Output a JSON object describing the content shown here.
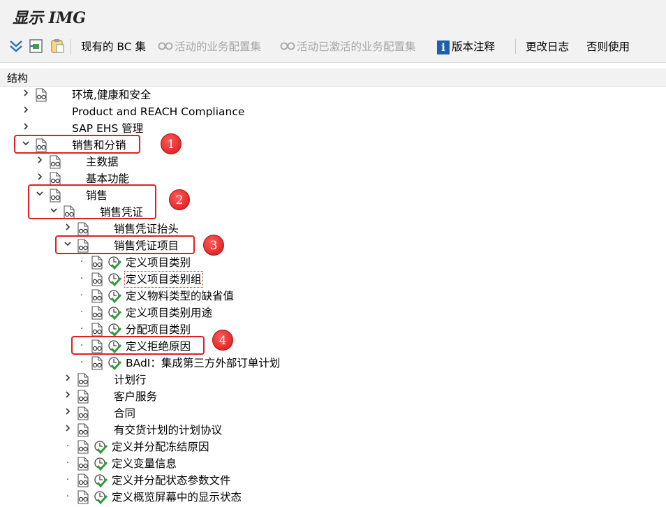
{
  "window": {
    "title": "显示 IMG"
  },
  "toolbar": {
    "bc_sets_label": "现有的 BC 集",
    "active_bc_label": "活动的业务配置集",
    "activated_bc_label": "活动已激活的业务配置集",
    "release_notes_label": "版本注释",
    "change_log_label": "更改日志",
    "otherwise_label": "否则使用"
  },
  "structure": {
    "header": "结构"
  },
  "tree": [
    {
      "label": "环境,健康和安全",
      "chevron": ">",
      "doc": true,
      "exec": false,
      "indent": 0
    },
    {
      "label": "Product and REACH Compliance",
      "chevron": ">",
      "doc": false,
      "exec": false,
      "indent": 0
    },
    {
      "label": "SAP EHS 管理",
      "chevron": ">",
      "doc": false,
      "exec": false,
      "indent": 0
    },
    {
      "label": "销售和分销",
      "chevron": "v",
      "doc": true,
      "exec": false,
      "indent": 0
    },
    {
      "label": "主数据",
      "chevron": ">",
      "doc": true,
      "exec": false,
      "indent": 1
    },
    {
      "label": "基本功能",
      "chevron": ">",
      "doc": true,
      "exec": false,
      "indent": 1
    },
    {
      "label": "销售",
      "chevron": "v",
      "doc": true,
      "exec": false,
      "indent": 1
    },
    {
      "label": "销售凭证",
      "chevron": "v",
      "doc": true,
      "exec": false,
      "indent": 2
    },
    {
      "label": "销售凭证抬头",
      "chevron": ">",
      "doc": true,
      "exec": false,
      "indent": 3
    },
    {
      "label": "销售凭证项目",
      "chevron": "v",
      "doc": true,
      "exec": false,
      "indent": 3
    },
    {
      "label": "定义项目类别",
      "chevron": "dot",
      "doc": true,
      "exec": true,
      "indent": 4
    },
    {
      "label": "定义项目类别组",
      "chevron": "dot",
      "doc": true,
      "exec": true,
      "indent": 4,
      "focused": true
    },
    {
      "label": "定义物料类型的缺省值",
      "chevron": "dot",
      "doc": true,
      "exec": true,
      "indent": 4
    },
    {
      "label": "定义项目类别用途",
      "chevron": "dot",
      "doc": true,
      "exec": true,
      "indent": 4
    },
    {
      "label": "分配项目类别",
      "chevron": "dot",
      "doc": true,
      "exec": true,
      "indent": 4
    },
    {
      "label": "定义拒绝原因",
      "chevron": "dot",
      "doc": true,
      "exec": true,
      "indent": 4
    },
    {
      "label": "BAdI：集成第三方外部订单计划",
      "chevron": "dot",
      "doc": true,
      "exec": true,
      "indent": 4
    },
    {
      "label": "计划行",
      "chevron": ">",
      "doc": true,
      "exec": false,
      "indent": 3
    },
    {
      "label": "客户服务",
      "chevron": ">",
      "doc": true,
      "exec": false,
      "indent": 3
    },
    {
      "label": "合同",
      "chevron": ">",
      "doc": true,
      "exec": false,
      "indent": 3
    },
    {
      "label": "有交货计划的计划协议",
      "chevron": ">",
      "doc": true,
      "exec": false,
      "indent": 3
    },
    {
      "label": "定义并分配冻结原因",
      "chevron": "dot",
      "doc": true,
      "exec": true,
      "indent": 3
    },
    {
      "label": "定义变量信息",
      "chevron": "dot",
      "doc": true,
      "exec": true,
      "indent": 3
    },
    {
      "label": "定义并分配状态参数文件",
      "chevron": "dot",
      "doc": true,
      "exec": true,
      "indent": 3
    },
    {
      "label": "定义概览屏幕中的显示状态",
      "chevron": "dot",
      "doc": true,
      "exec": true,
      "indent": 3
    }
  ],
  "annotations": [
    "1",
    "2",
    "3",
    "4"
  ],
  "colors": {
    "highlight": "#e02020",
    "badge": "#d61515",
    "exec_green": "#2e9e3a",
    "info_blue": "#1f5fae"
  }
}
